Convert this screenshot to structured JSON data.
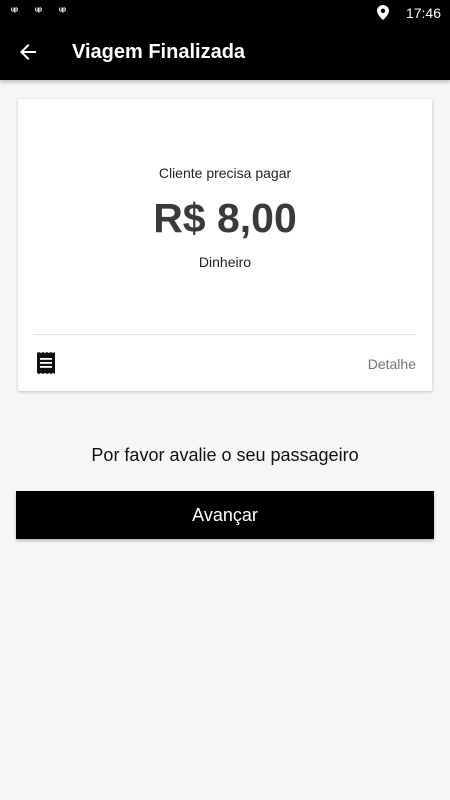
{
  "status_bar": {
    "notifications": [
      "ᵘᵖ",
      "ᵘᵖ",
      "ᵘᵖ"
    ],
    "location_icon": "location-pin-icon",
    "time": "17:46"
  },
  "app_bar": {
    "back_icon": "arrow-left-icon",
    "title": "Viagem Finalizada"
  },
  "payment_card": {
    "caption": "Cliente precisa pagar",
    "amount": "R$ 8,00",
    "method": "Dinheiro",
    "receipt_icon": "receipt-icon",
    "detail_label": "Detalhe"
  },
  "rating": {
    "prompt": "Por favor avalie o seu passageiro"
  },
  "actions": {
    "advance_label": "Avançar"
  },
  "colors": {
    "app_bar": "#000000",
    "background": "#f7f6f6",
    "card": "#ffffff",
    "button": "#000000"
  }
}
